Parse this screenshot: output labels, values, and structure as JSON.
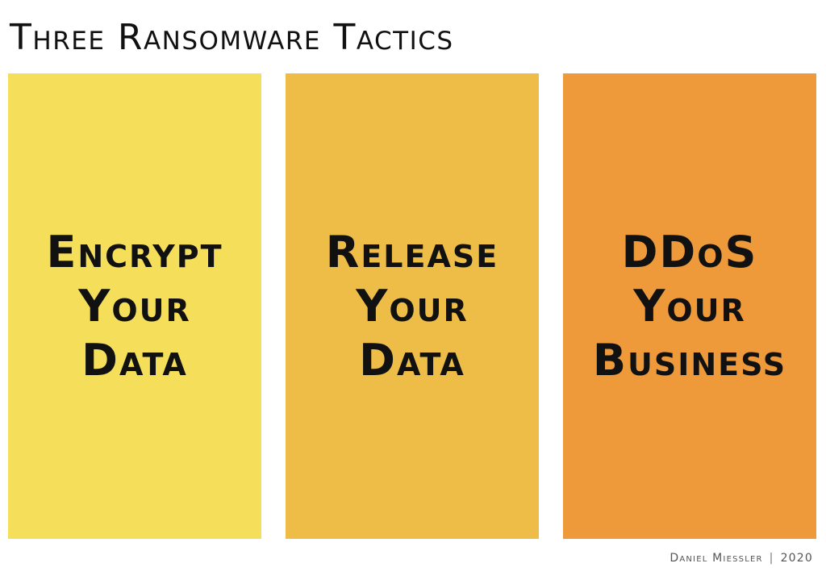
{
  "title": "Three Ransomware Tactics",
  "tactics": [
    {
      "lines": [
        "Encrypt",
        "Your",
        "Data"
      ],
      "color": "#f5df5a"
    },
    {
      "lines": [
        "Release",
        "Your",
        "Data"
      ],
      "color": "#edbd47"
    },
    {
      "lines": [
        "DDoS",
        "Your",
        "Business"
      ],
      "color": "#ee9a3a"
    }
  ],
  "credit": {
    "author": "Daniel Miessler",
    "separator": "|",
    "year": "2020"
  }
}
